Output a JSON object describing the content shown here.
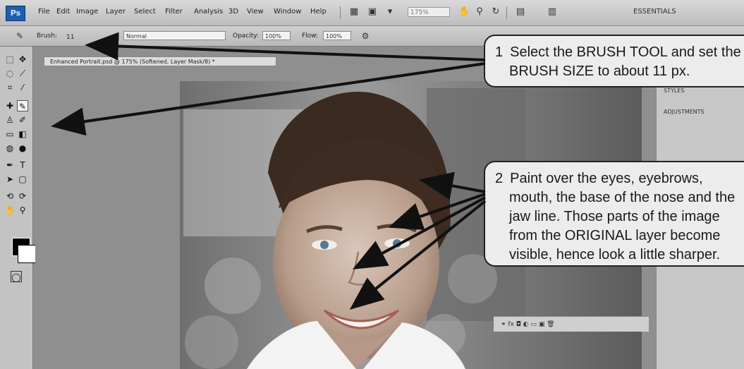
{
  "menubar": {
    "logo": "Ps",
    "items": [
      "File",
      "Edit",
      "Image",
      "Layer",
      "Select",
      "Filter",
      "Analysis",
      "3D",
      "View",
      "Window",
      "Help"
    ],
    "zoom": "175%",
    "workspace": "ESSENTIALS"
  },
  "options_bar": {
    "brush_label": "Brush:",
    "brush_size": "11",
    "mode_value": "Normal",
    "opacity_label": "Opacity:",
    "opacity_value": "100%",
    "flow_label": "Flow:",
    "flow_value": "100%"
  },
  "document": {
    "tab_title": "Enhanced Portrait.psd @ 175% (Softened, Layer Mask/8) *"
  },
  "panel": {
    "items": [
      "STYLES",
      "ADJUSTMENTS"
    ]
  },
  "callouts": {
    "step1": {
      "number": "1",
      "lines": [
        "Select the BRUSH TOOL and set the",
        "BRUSH SIZE to about 11 px."
      ]
    },
    "step2": {
      "number": "2",
      "lines": [
        "Paint over the eyes, eyebrows,",
        "mouth, the base of the nose and the",
        "jaw line.  Those parts of the image",
        "from the ORIGINAL layer become",
        "visible, hence look a little sharper."
      ]
    }
  }
}
